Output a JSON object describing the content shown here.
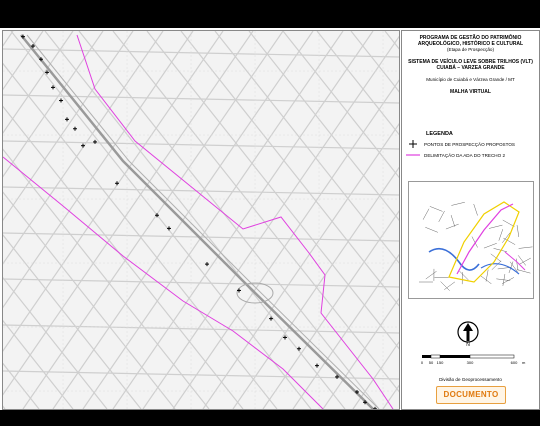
{
  "title_block": {
    "line1": "PROGRAMA DE GESTÃO DO PATRIMÔNIO",
    "line2": "ARQUEOLÓGICO, HISTÓRICO E CULTURAL",
    "line3": "(Etapa de Prospecção)",
    "line4": "SISTEMA DE VEÍCULO LEVE SOBRE TRILHOS (VLT)",
    "line5": "CUIABÁ – VARZEA GRANDE",
    "line6": "Município de Cuiabá e Várzea Grande / MT",
    "line7": "MALHA VIRTUAL"
  },
  "legend": {
    "title": "LEGENDA",
    "items": [
      {
        "label": "PONTOS DE PROSPECÇÃO PROPOSTOS",
        "symbol": "point-cross-icon"
      },
      {
        "label": "DELIMITAÇÃO DA ADA DO TRECHO 2",
        "symbol": "magenta-line",
        "color": "#e040e0"
      }
    ]
  },
  "scale": {
    "ticks": [
      "0",
      "50",
      "150",
      "300",
      "600"
    ],
    "unit": "m"
  },
  "footer": {
    "division": "Divisão de Geoprocessamento",
    "logo_text": "DOCUMENTO"
  },
  "colors": {
    "ada_boundary": "#e040e0",
    "streets": "#c8c8c8",
    "logo": "#e07a10"
  }
}
